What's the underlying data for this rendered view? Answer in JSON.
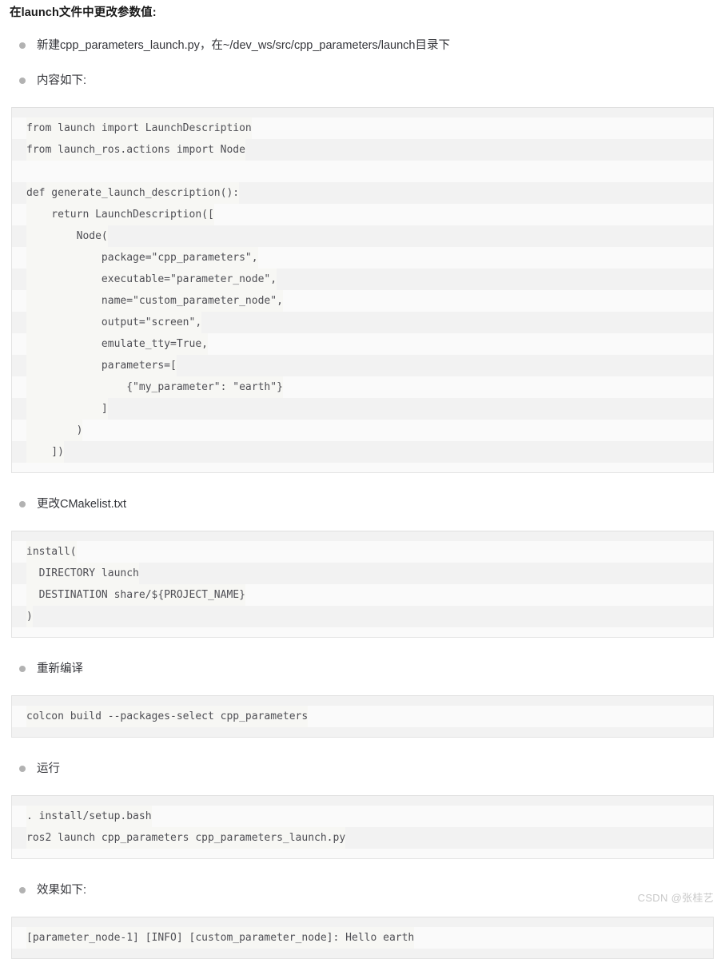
{
  "document": {
    "heading": "在launch文件中更改参数值:",
    "watermark": "CSDN @张桂艺"
  },
  "sections": [
    {
      "bullet": "新建cpp_parameters_launch.py，在~/dev_ws/src/cpp_parameters/launch目录下"
    },
    {
      "bullet": "内容如下:"
    },
    {
      "bullet": "更改CMakelist.txt"
    },
    {
      "bullet": "重新编译"
    },
    {
      "bullet": "运行"
    },
    {
      "bullet": "效果如下:"
    }
  ],
  "code_blocks": {
    "launch_py": {
      "language": "python",
      "lines": [
        "from launch import LaunchDescription",
        "from launch_ros.actions import Node",
        "",
        "def generate_launch_description():",
        "    return LaunchDescription([",
        "        Node(",
        "            package=\"cpp_parameters\",",
        "            executable=\"parameter_node\",",
        "            name=\"custom_parameter_node\",",
        "            output=\"screen\",",
        "            emulate_tty=True,",
        "            parameters=[",
        "                {\"my_parameter\": \"earth\"}",
        "            ]",
        "        )",
        "    ])"
      ]
    },
    "cmakelists": {
      "language": "cmake",
      "lines": [
        "install(",
        "  DIRECTORY launch",
        "  DESTINATION share/${PROJECT_NAME}",
        ")"
      ]
    },
    "build": {
      "language": "bash",
      "lines": [
        "colcon build --packages-select cpp_parameters"
      ]
    },
    "run": {
      "language": "bash",
      "lines": [
        ". install/setup.bash",
        "ros2 launch cpp_parameters cpp_parameters_launch.py"
      ]
    },
    "output": {
      "language": "text",
      "lines": [
        "[parameter_node-1] [INFO] [custom_parameter_node]: Hello earth"
      ]
    }
  }
}
